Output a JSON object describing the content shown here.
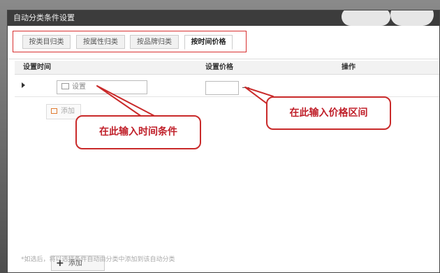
{
  "dialog": {
    "title": "自动分类条件设置"
  },
  "tabs": [
    {
      "label": "按类目归类",
      "active": false
    },
    {
      "label": "按属性归类",
      "active": false
    },
    {
      "label": "按品牌归类",
      "active": false
    },
    {
      "label": "按时间价格",
      "active": true
    }
  ],
  "table": {
    "headers": {
      "time": "设置时间",
      "price": "设置价格",
      "action": "操作"
    },
    "row": {
      "set_button_label": "设置"
    }
  },
  "add_condition_label": "添加",
  "add_button_label": "添加",
  "callouts": {
    "time": "在此输入时间条件",
    "price": "在此输入价格区间"
  },
  "footnote": "*如选后，将以选择条件自动由分类中添加到该自动分类",
  "colors": {
    "callout_border": "#c92a2a",
    "callout_text": "#c0202a",
    "titlebar": "#3c3c3c"
  }
}
